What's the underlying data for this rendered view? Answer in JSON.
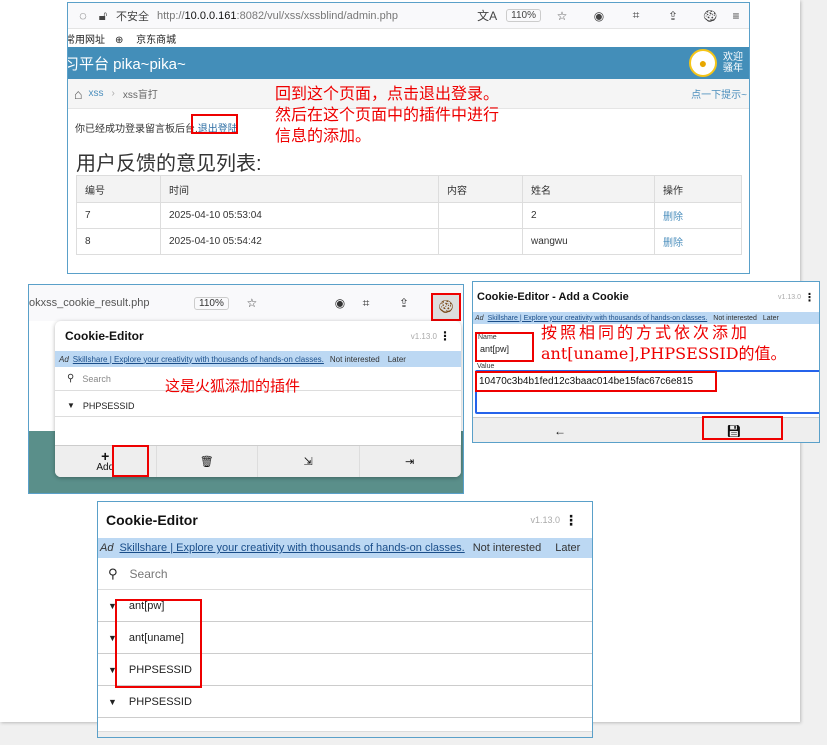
{
  "browser": {
    "security": "不安全",
    "url_prefix": "http://",
    "url_host": "10.0.0.161",
    "url_path": ":8082/vul/xss/xssblind/admin.php",
    "translate_icon": "文A",
    "zoom": "110%",
    "bookmarks": [
      "常用网址",
      "京东商城"
    ]
  },
  "site": {
    "title": "习平台 pika~pika~",
    "welcome_line1": "欢迎",
    "welcome_line2": "骚年",
    "breadcrumb": {
      "section": "xss",
      "page": "xss盲打"
    },
    "hint": "点一下提示~",
    "message": "你已经成功登录留言板后台,",
    "logout_link": "退出登陆",
    "list_title": "用户反馈的意见列表:",
    "table": {
      "headers": [
        "编号",
        "时间",
        "内容",
        "姓名",
        "操作"
      ],
      "rows": [
        [
          "7",
          "2025-04-10 05:53:04",
          "",
          "2",
          "删除"
        ],
        [
          "8",
          "2025-04-10 05:54:42",
          "",
          "wangwu",
          "删除"
        ]
      ]
    }
  },
  "annotations": {
    "step1_line1": "回到这个页面，点击退出登录。",
    "step1_line2": "然后在这个页面中的插件中进行",
    "step1_line3": "信息的添加。",
    "plugin_note": "这是火狐添加的插件",
    "add_line1": "按照相同的方式依次添加",
    "add_line2": "ant[uname],PHPSESSID的值。"
  },
  "toolbar2": {
    "url": "okxss_cookie_result.php",
    "zoom": "110%"
  },
  "cookie_editor": {
    "title": "Cookie-Editor",
    "version": "v1.13.0",
    "ad_label": "Ad",
    "ad_text": "Skillshare | Explore your creativity with thousands of hands-on classes.",
    "not_interested": "Not interested",
    "later": "Later",
    "search_placeholder": "Search",
    "cookies_initial": [
      "PHPSESSID"
    ],
    "add_label": "Add"
  },
  "add_cookie": {
    "title": "Cookie-Editor - Add a Cookie",
    "version": "v1.13.0",
    "name_label": "Name",
    "name_value": "ant[pw]",
    "value_label": "Value",
    "value_value": "10470c3b4b1fed12c3baac014be15fac67c6e815"
  },
  "cookie_list_final": {
    "title": "Cookie-Editor",
    "version": "v1.13.0",
    "cookies": [
      "ant[pw]",
      "ant[uname]",
      "PHPSESSID",
      "PHPSESSID"
    ]
  },
  "colors": {
    "header_blue": "#438eb9",
    "annotation_red": "#ee0000",
    "ad_blue": "#bcd8f3"
  }
}
